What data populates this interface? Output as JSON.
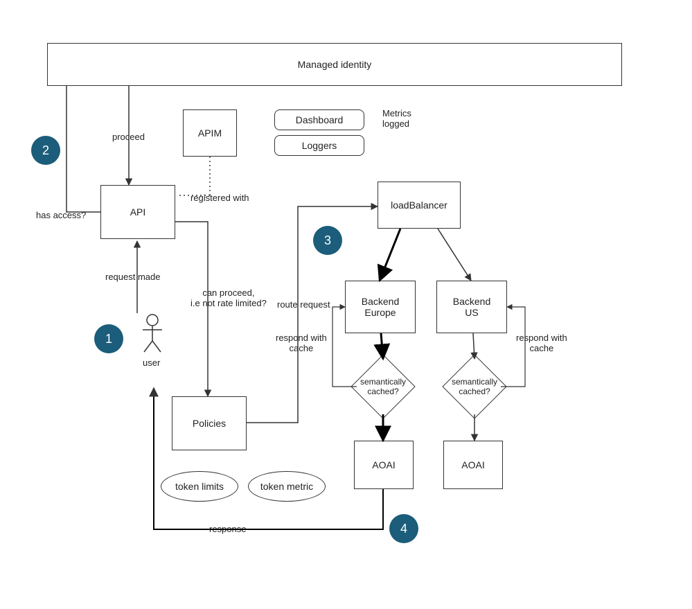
{
  "colors": {
    "badge_bg": "#1b5d7a",
    "box_border": "#333333"
  },
  "badges": {
    "b1": "1",
    "b2": "2",
    "b3": "3",
    "b4": "4"
  },
  "nodes": {
    "managed_identity": "Managed identity",
    "apim": "APIM",
    "dashboard": "Dashboard",
    "loggers": "Loggers",
    "metrics_logged": "Metrics\nlogged",
    "api": "API",
    "user": "user",
    "policies": "Policies",
    "token_limits": "token limits",
    "token_metric": "token metric",
    "load_balancer": "loadBalancer",
    "backend_eu": "Backend\nEurope",
    "backend_us": "Backend\nUS",
    "sem_cached_eu": "semantically\ncached?",
    "sem_cached_us": "semantically\ncached?",
    "aoai_eu": "AOAI",
    "aoai_us": "AOAI"
  },
  "edges": {
    "proceed": "proceed",
    "registered_with": "registered with",
    "has_access": "has access?",
    "request_made": "request made",
    "can_proceed": "can proceed,\ni.e not rate limited?",
    "route_request": "route request",
    "respond_cache_eu": "respond with\ncache",
    "respond_cache_us": "respond with\ncache",
    "response": "response"
  },
  "diagram_description": {
    "type": "architecture-flow",
    "summary": "User request flows through API (under Managed Identity / APIM), Policies check rate limits, request is routed to a loadBalancer which distributes to Backend Europe or Backend US. Each backend checks a semantic cache; on miss it calls AOAI. Response returns to user. Dashboard/Loggers capture metrics."
  }
}
